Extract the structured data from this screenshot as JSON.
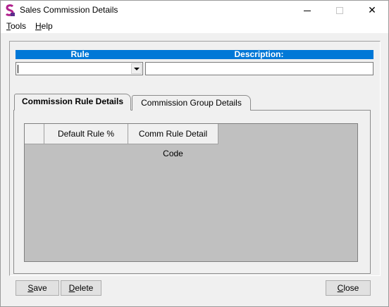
{
  "window": {
    "title": "Sales Commission Details",
    "icon": "app-s-icon",
    "controls": [
      "minimize-icon",
      "maximize-icon",
      "close-icon"
    ],
    "close_glyph": "✕"
  },
  "menu": {
    "items": [
      {
        "accel": "T",
        "rest": "ools"
      },
      {
        "accel": "H",
        "rest": "elp"
      }
    ]
  },
  "form": {
    "rule_header": "Rule",
    "description_header": "Description:",
    "rule_value": "",
    "description_value": ""
  },
  "tabs": [
    {
      "label": "Commission Rule Details",
      "active": true
    },
    {
      "label": "Commission Group Details",
      "active": false
    }
  ],
  "grid": {
    "columns": [
      "Default Rule %",
      "Comm Rule Detail Code"
    ],
    "rows": []
  },
  "buttons": {
    "save": {
      "accel": "S",
      "rest": "ave"
    },
    "delete": {
      "accel": "D",
      "rest": "elete"
    },
    "close": {
      "accel": "C",
      "rest": "lose"
    }
  },
  "colors": {
    "header_bar": "#0078d7",
    "grid_background": "#c0c0c0",
    "window_background": "#f0f0f0"
  }
}
